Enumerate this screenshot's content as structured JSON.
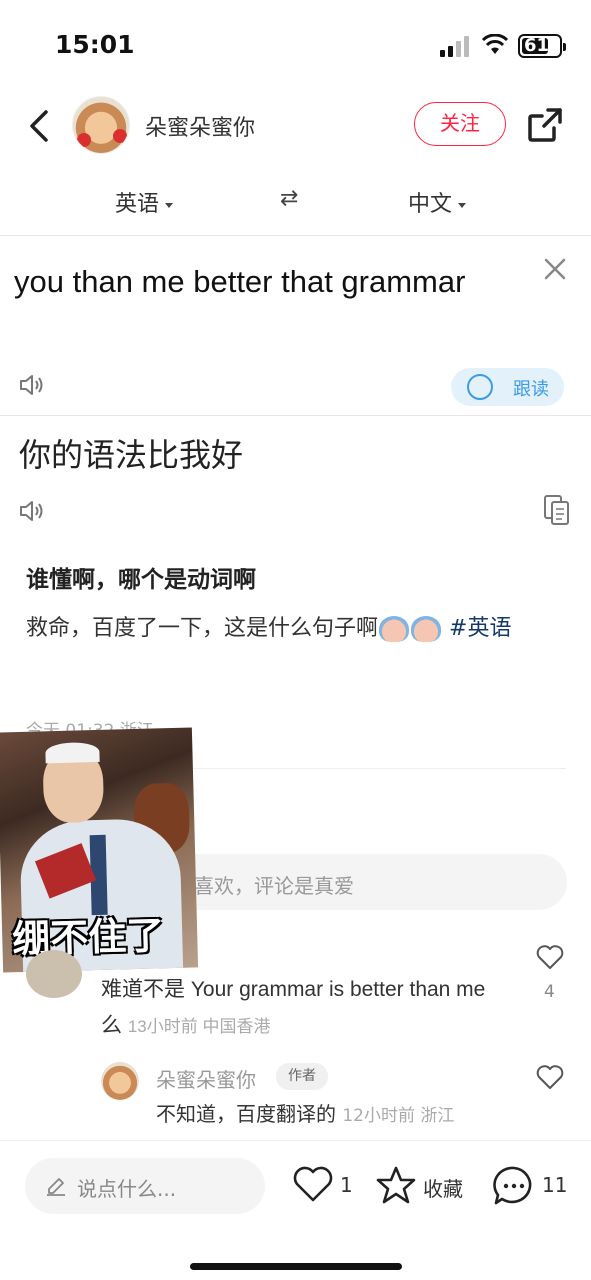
{
  "status_bar": {
    "time": "15:01",
    "battery": "61"
  },
  "header": {
    "author_name": "朵蜜朵蜜你",
    "follow_label": "关注"
  },
  "language_bar": {
    "source": "英语",
    "swap": "⇄",
    "target": "中文"
  },
  "source": {
    "text": "you than me better that grammar",
    "follow_read_label": "跟读"
  },
  "translation": {
    "text": "你的语法比我好"
  },
  "post": {
    "title": "谁懂啊，哪个是动词啊",
    "body": "救命，百度了一下，这是什么句子啊",
    "hashtag": "#英语",
    "meta": "今天 01:32 浙江",
    "meme_caption": "绷不住了"
  },
  "comment_box": {
    "placeholder": "喜欢，评论是真爱"
  },
  "comments": [
    {
      "text": "难道不是 Your grammar is better than me么",
      "meta": "13小时前 中国香港",
      "likes": "4"
    }
  ],
  "reply": {
    "name": "朵蜜朵蜜你",
    "badge": "作者",
    "text": "不知道，百度翻译的",
    "meta": "12小时前 浙江"
  },
  "bottom_bar": {
    "say_placeholder": "说点什么...",
    "like_count": "1",
    "collect_label": "收藏",
    "comment_count": "11"
  },
  "colors": {
    "accent_red": "#ff2442",
    "tag_blue": "#13386c",
    "read_blue": "#3b9be6"
  }
}
